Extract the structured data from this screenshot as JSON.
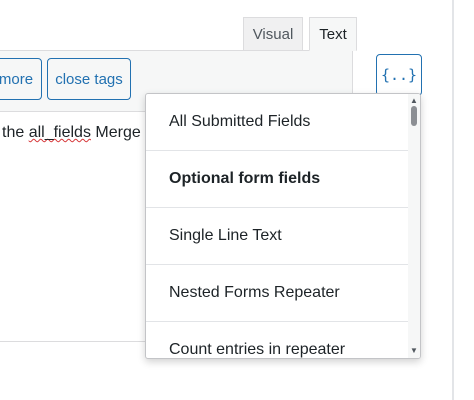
{
  "editor": {
    "tabs": [
      {
        "label": "Visual"
      },
      {
        "label": "Text"
      }
    ],
    "quicktags": {
      "more_label": "more",
      "close_tags_label": "close tags"
    },
    "content": {
      "prefix": "the ",
      "misspelled": "all_fields",
      "suffix": " Merge"
    }
  },
  "merge_tags_button": {
    "label": "{..}"
  },
  "dropdown": {
    "items": [
      {
        "label": "All Submitted Fields",
        "is_header": false
      },
      {
        "label": "Optional form fields",
        "is_header": true
      },
      {
        "label": "Single Line Text",
        "is_header": false
      },
      {
        "label": "Nested Forms Repeater",
        "is_header": false
      },
      {
        "label": "Count entries in repeater",
        "is_header": false
      }
    ],
    "scroll_up_icon": "▲",
    "scroll_down_icon": "▼"
  },
  "colors": {
    "accent": "#2271b1",
    "text": "#1d2327",
    "misspell_underline": "#d63638"
  }
}
